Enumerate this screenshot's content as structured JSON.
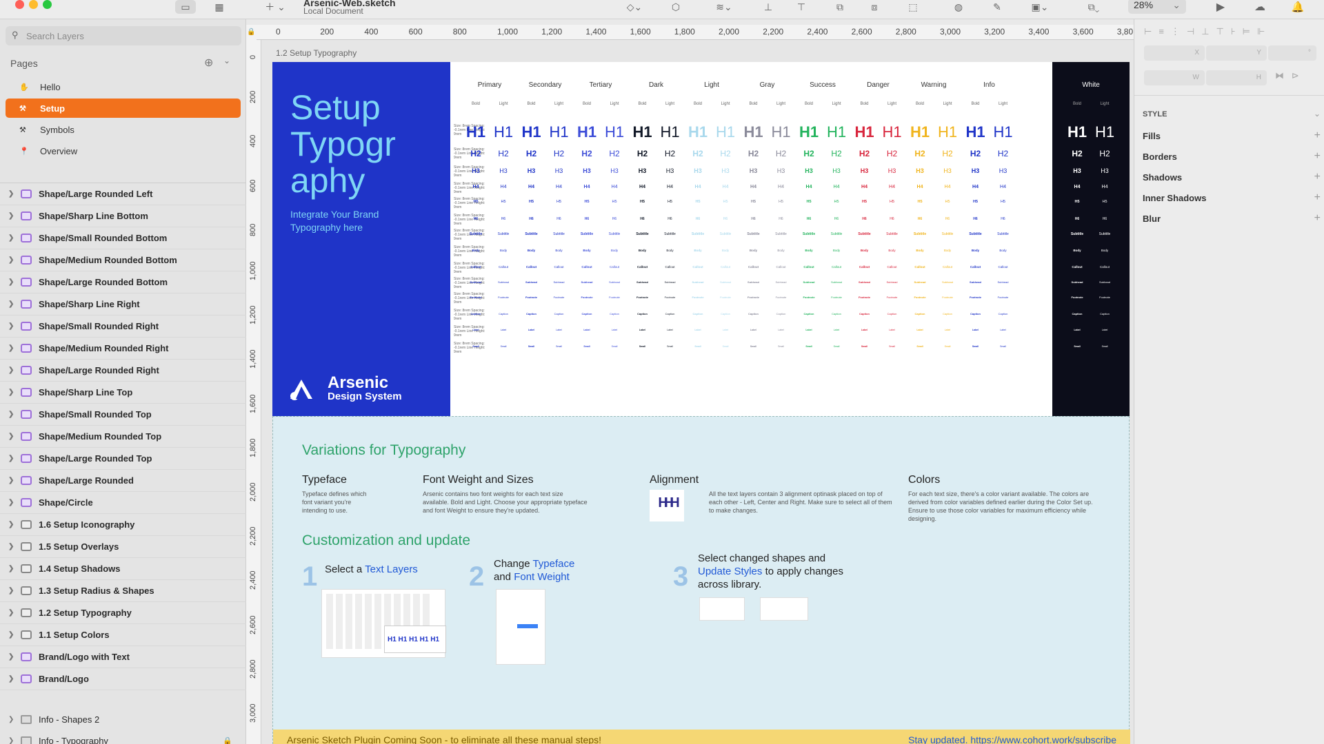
{
  "window": {
    "document_name": "Arsenic-Web.sketch",
    "document_subtitle": "Local Document",
    "zoom": "28%"
  },
  "sidebar": {
    "search_placeholder": "Search Layers",
    "pages_label": "Pages",
    "pages": [
      {
        "label": "Hello",
        "icon": "hand-icon"
      },
      {
        "label": "Setup",
        "icon": "tools-icon",
        "selected": true
      },
      {
        "label": "Symbols",
        "icon": "tools-icon"
      },
      {
        "label": "Overview",
        "icon": "pin-icon"
      }
    ],
    "layers": [
      "Shape/Large Rounded Left",
      "Shape/Sharp Line Bottom",
      "Shape/Small Rounded Bottom",
      "Shape/Medium Rounded Bottom",
      "Shape/Large Rounded Bottom",
      "Shape/Sharp Line Right",
      "Shape/Small Rounded Right",
      "Shape/Medium Rounded Right",
      "Shape/Large Rounded Right",
      "Shape/Sharp Line Top",
      "Shape/Small Rounded Top",
      "Shape/Medium Rounded Top",
      "Shape/Large Rounded Top",
      "Shape/Large Rounded",
      "Shape/Circle",
      "1.6 Setup Iconography",
      "1.5 Setup Overlays",
      "1.4 Setup Shadows",
      "1.3 Setup Radius & Shapes",
      "1.2 Setup Typography",
      "1.1 Setup Colors",
      "Brand/Logo with Text",
      "Brand/Logo"
    ],
    "folders": [
      "Info - Shapes 2",
      "Info - Typography"
    ]
  },
  "rulers": {
    "top": [
      "0",
      "200",
      "400",
      "600",
      "800",
      "1,000",
      "1,200",
      "1,400",
      "1,600",
      "1,800",
      "2,000",
      "2,200",
      "2,400",
      "2,600",
      "2,800",
      "3,000",
      "3,200",
      "3,400",
      "3,600",
      "3,80"
    ],
    "left": [
      "0",
      "200",
      "400",
      "600",
      "800",
      "1,000",
      "1,200",
      "1,400",
      "1,600",
      "1,800",
      "2,000",
      "2,200",
      "2,400",
      "2,600",
      "2,800",
      "3,000"
    ]
  },
  "artboard": {
    "label": "1.2 Setup Typography",
    "hero_title": "Setup Typogr aphy",
    "hero_subtitle": "Integrate Your Brand Typography here",
    "logo_name": "Arsenic",
    "logo_sub": "Design System",
    "columns": [
      {
        "name": "Primary",
        "color": "#1f34c8"
      },
      {
        "name": "Secondary",
        "color": "#1f34c8"
      },
      {
        "name": "Tertiary",
        "color": "#3c4cd8"
      },
      {
        "name": "Dark",
        "color": "#111827"
      },
      {
        "name": "Light",
        "color": "#a8d8ec"
      },
      {
        "name": "Gray",
        "color": "#8a8a9a"
      },
      {
        "name": "Success",
        "color": "#22b35c"
      },
      {
        "name": "Danger",
        "color": "#d8253c"
      },
      {
        "name": "Warning",
        "color": "#f0b41c"
      },
      {
        "name": "Info",
        "color": "#1f34c8"
      }
    ],
    "white_column": "White",
    "weights": [
      "Bold",
      "Light"
    ],
    "rows": [
      "H1",
      "H2",
      "H3",
      "H4",
      "H5",
      "H6",
      "Subtitle",
      "Body",
      "Callout",
      "Subhead",
      "Footnote",
      "Caption",
      "Label",
      "Small"
    ],
    "row_meta": "Size: 8rem Spacing: -0.1rem Line Height: 9rem"
  },
  "lower": {
    "variations_title": "Variations for Typography",
    "typeface_title": "Typeface",
    "typeface_desc": "Typeface defines which font variant you're intending to use.",
    "weight_title": "Font Weight and Sizes",
    "weight_desc": "Arsenic contains two font weights for each text size available. Bold and Light. Choose your appropriate typeface and font Weight to ensure they're updated.",
    "alignment_title": "Alignment",
    "alignment_desc": "All the text layers contain 3 alignment optinask placed on top of each other - Left, Center and Right. Make sure to select all of them to make changes.",
    "colors_title": "Colors",
    "colors_desc": "For each text size, there's a color variant available. The colors are derived from color variables defined earlier during the Color Set up. Ensure to use those color variables for maximum efficiency while designing.",
    "custom_title": "Customization and update",
    "step1_num": "1",
    "step1_text": "Select a",
    "step1_link": "Text Layers",
    "step2_num": "2",
    "step2_text_a": "Change",
    "step2_link_a": "Typeface",
    "step2_text_b": "and",
    "step2_link_b": "Font Weight",
    "step3_num": "3",
    "step3_text_a": "Select changed shapes and",
    "step3_link": "Update Styles",
    "step3_text_b": "to apply changes across library.",
    "banner_left": "Arsenic Sketch Plugin Coming Soon - to eliminate all these manual steps!",
    "banner_right": "Stay updated. https://www.cohort.work/subscribe"
  },
  "inspector": {
    "style_label": "STYLE",
    "sections": [
      "Fills",
      "Borders",
      "Shadows",
      "Inner Shadows",
      "Blur"
    ],
    "field_labels": [
      "X",
      "Y",
      "°",
      "W",
      "H"
    ]
  }
}
